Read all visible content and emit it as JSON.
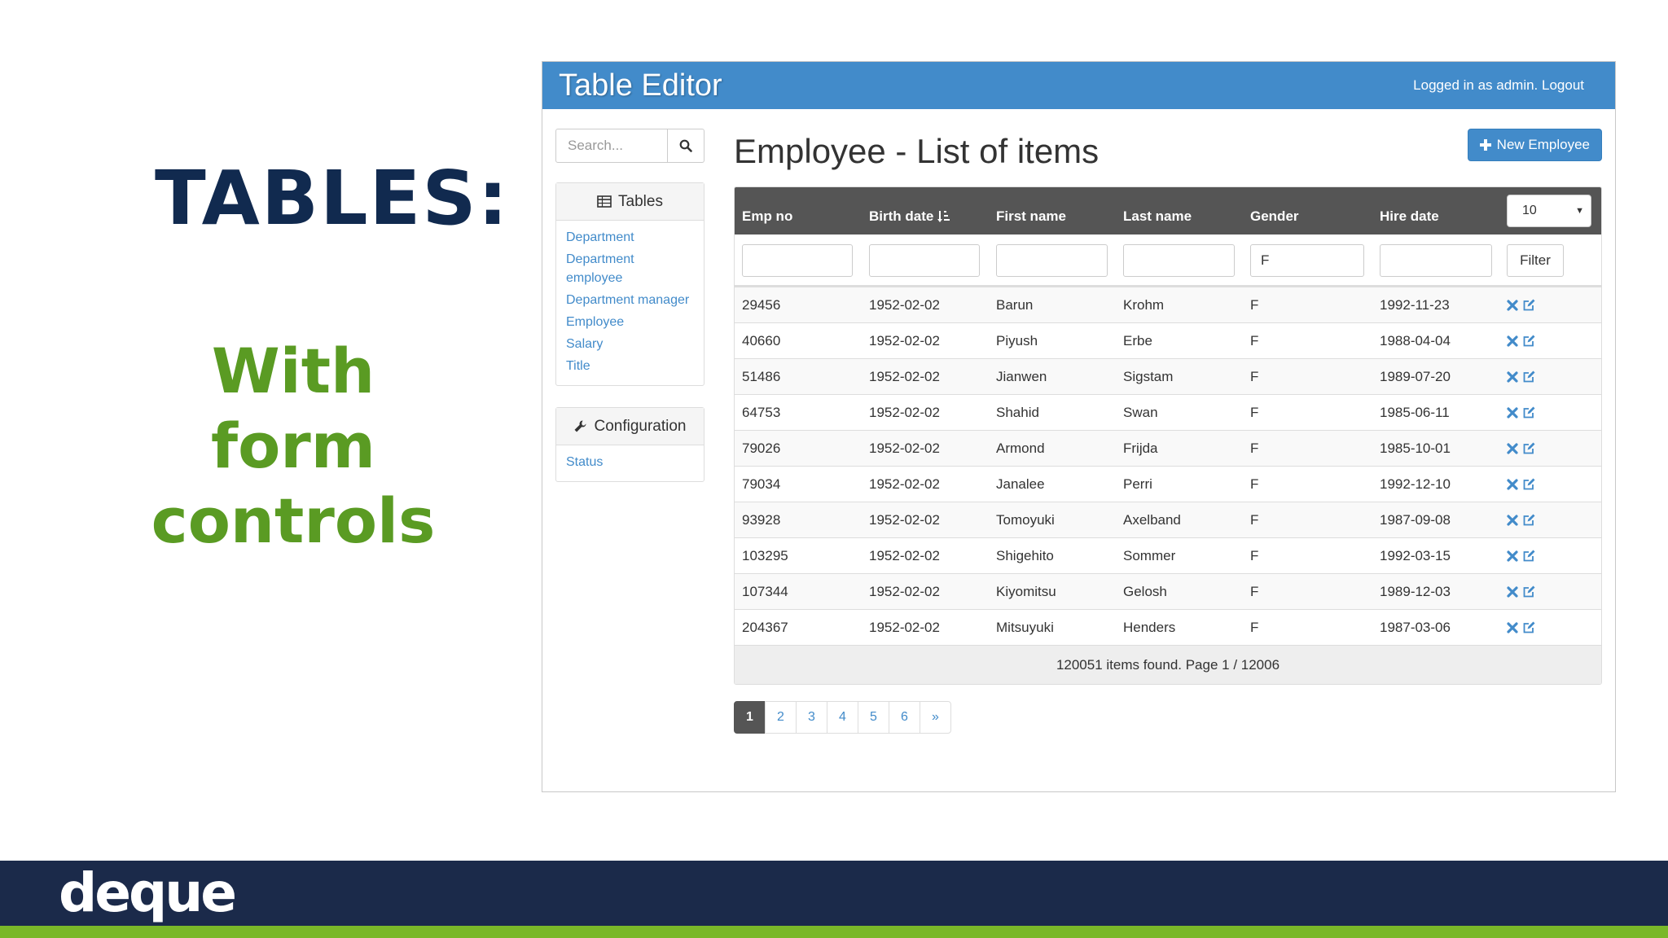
{
  "slide": {
    "title": "TABLES:",
    "subtitle": "With form controls",
    "logo": "deque"
  },
  "app": {
    "title": "Table Editor",
    "login_text": "Logged in as admin. Logout",
    "search_placeholder": "Search...",
    "tables_panel": {
      "heading": "Tables",
      "links": [
        "Department",
        "Department employee",
        "Department manager",
        "Employee",
        "Salary",
        "Title"
      ]
    },
    "config_panel": {
      "heading": "Configuration",
      "links": [
        "Status"
      ]
    },
    "page_title": "Employee - List of items",
    "new_button": "New Employee",
    "columns": [
      "Emp no",
      "Birth date",
      "First name",
      "Last name",
      "Gender",
      "Hire date"
    ],
    "page_size": "10",
    "filters": [
      "",
      "",
      "",
      "",
      "F",
      ""
    ],
    "filter_button": "Filter",
    "rows": [
      [
        "29456",
        "1952-02-02",
        "Barun",
        "Krohm",
        "F",
        "1992-11-23"
      ],
      [
        "40660",
        "1952-02-02",
        "Piyush",
        "Erbe",
        "F",
        "1988-04-04"
      ],
      [
        "51486",
        "1952-02-02",
        "Jianwen",
        "Sigstam",
        "F",
        "1989-07-20"
      ],
      [
        "64753",
        "1952-02-02",
        "Shahid",
        "Swan",
        "F",
        "1985-06-11"
      ],
      [
        "79026",
        "1952-02-02",
        "Armond",
        "Frijda",
        "F",
        "1985-10-01"
      ],
      [
        "79034",
        "1952-02-02",
        "Janalee",
        "Perri",
        "F",
        "1992-12-10"
      ],
      [
        "93928",
        "1952-02-02",
        "Tomoyuki",
        "Axelband",
        "F",
        "1987-09-08"
      ],
      [
        "103295",
        "1952-02-02",
        "Shigehito",
        "Sommer",
        "F",
        "1992-03-15"
      ],
      [
        "107344",
        "1952-02-02",
        "Kiyomitsu",
        "Gelosh",
        "F",
        "1989-12-03"
      ],
      [
        "204367",
        "1952-02-02",
        "Mitsuyuki",
        "Henders",
        "F",
        "1987-03-06"
      ]
    ],
    "footer_text": "120051 items found. Page 1 / 12006",
    "pages": [
      "1",
      "2",
      "3",
      "4",
      "5",
      "6",
      "»"
    ],
    "colors": {
      "header_blue": "#428bca",
      "table_head": "#555555",
      "delete_icon": "#428bca"
    }
  }
}
